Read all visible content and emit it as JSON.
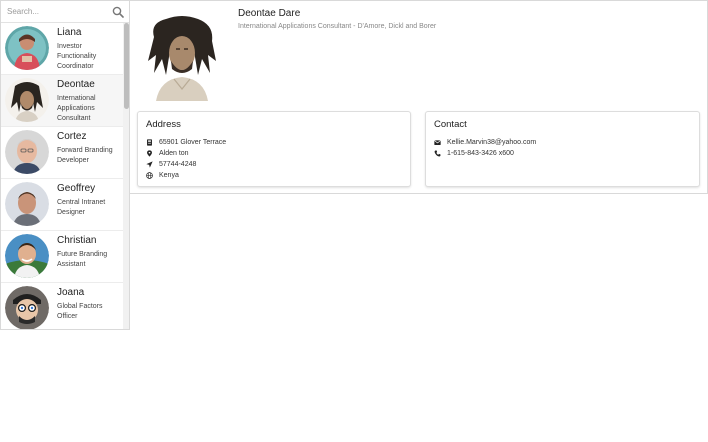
{
  "search": {
    "placeholder": "Search..."
  },
  "contacts": [
    {
      "name": "Liana",
      "title": [
        "Investor",
        "Functionality",
        "Coordinator"
      ]
    },
    {
      "name": "Deontae",
      "title": [
        "International",
        "Applications",
        "Consultant"
      ]
    },
    {
      "name": "Cortez",
      "title": [
        "Forward Branding",
        "Developer"
      ]
    },
    {
      "name": "Geoffrey",
      "title": [
        "Central Intranet",
        "Designer"
      ]
    },
    {
      "name": "Christian",
      "title": [
        "Future Branding",
        "Assistant"
      ]
    },
    {
      "name": "Joana",
      "title": [
        "Global Factors",
        "Officer"
      ]
    }
  ],
  "profile": {
    "name": "Deontae Dare",
    "subtitle": "International Applications Consultant - D'Amore, Dickl and Borer"
  },
  "address": {
    "heading": "Address",
    "street": "65901 Glover Terrace",
    "city": "Alden ton",
    "zip": "57744-4248",
    "country": "Kenya"
  },
  "contact": {
    "heading": "Contact",
    "email": "Kellie.Marvin38@yahoo.com",
    "phone": "1-615-843-3426 x600"
  },
  "colors": {
    "border": "#d9d9d9",
    "scroll_thumb": "#bdbdbd",
    "muted_text": "#888888"
  }
}
